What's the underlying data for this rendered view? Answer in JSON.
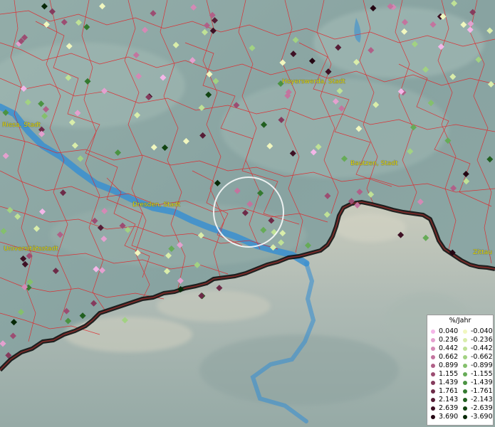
{
  "cities": [
    {
      "name": "Riesa, Stadt"
    },
    {
      "name": "Hoyerswerda, Stadt"
    },
    {
      "name": "Bautzen, Stadt"
    },
    {
      "name": "Dresden, Stadt"
    },
    {
      "name": "Universitätsstadt"
    },
    {
      "name": "Zittau"
    }
  ],
  "legend": {
    "title": "%/Jahr",
    "positive": [
      {
        "label": "0.040",
        "color": "#f4b6e8"
      },
      {
        "label": "0.236",
        "color": "#e4a0cf"
      },
      {
        "label": "0.442",
        "color": "#d489b5"
      },
      {
        "label": "0.662",
        "color": "#c3749e"
      },
      {
        "label": "0.899",
        "color": "#b06088"
      },
      {
        "label": "1.155",
        "color": "#9c4d72"
      },
      {
        "label": "1.439",
        "color": "#853b5d"
      },
      {
        "label": "1.761",
        "color": "#6d2b48"
      },
      {
        "label": "2.143",
        "color": "#561d36"
      },
      {
        "label": "2.639",
        "color": "#3e1024"
      },
      {
        "label": "3.690",
        "color": "#240612"
      }
    ],
    "negative": [
      {
        "label": "-0.040",
        "color": "#f1f7bf"
      },
      {
        "label": "-0.236",
        "color": "#d9edaa"
      },
      {
        "label": "-0.442",
        "color": "#bfe196"
      },
      {
        "label": "-0.662",
        "color": "#a2d282"
      },
      {
        "label": "-0.899",
        "color": "#84c06c"
      },
      {
        "label": "-1.155",
        "color": "#66ab57"
      },
      {
        "label": "-1.439",
        "color": "#4b9342"
      },
      {
        "label": "-1.761",
        "color": "#347a30"
      },
      {
        "label": "-2.143",
        "color": "#215f20"
      },
      {
        "label": "-2.639",
        "color": "#124412"
      },
      {
        "label": "-3.690",
        "color": "#072807"
      }
    ]
  },
  "colors": {
    "terrain": "#8fa8a6",
    "river": "#3a8fd0",
    "district_border": "#e0262a",
    "country_border": "#111111",
    "label": "#e6e000"
  }
}
